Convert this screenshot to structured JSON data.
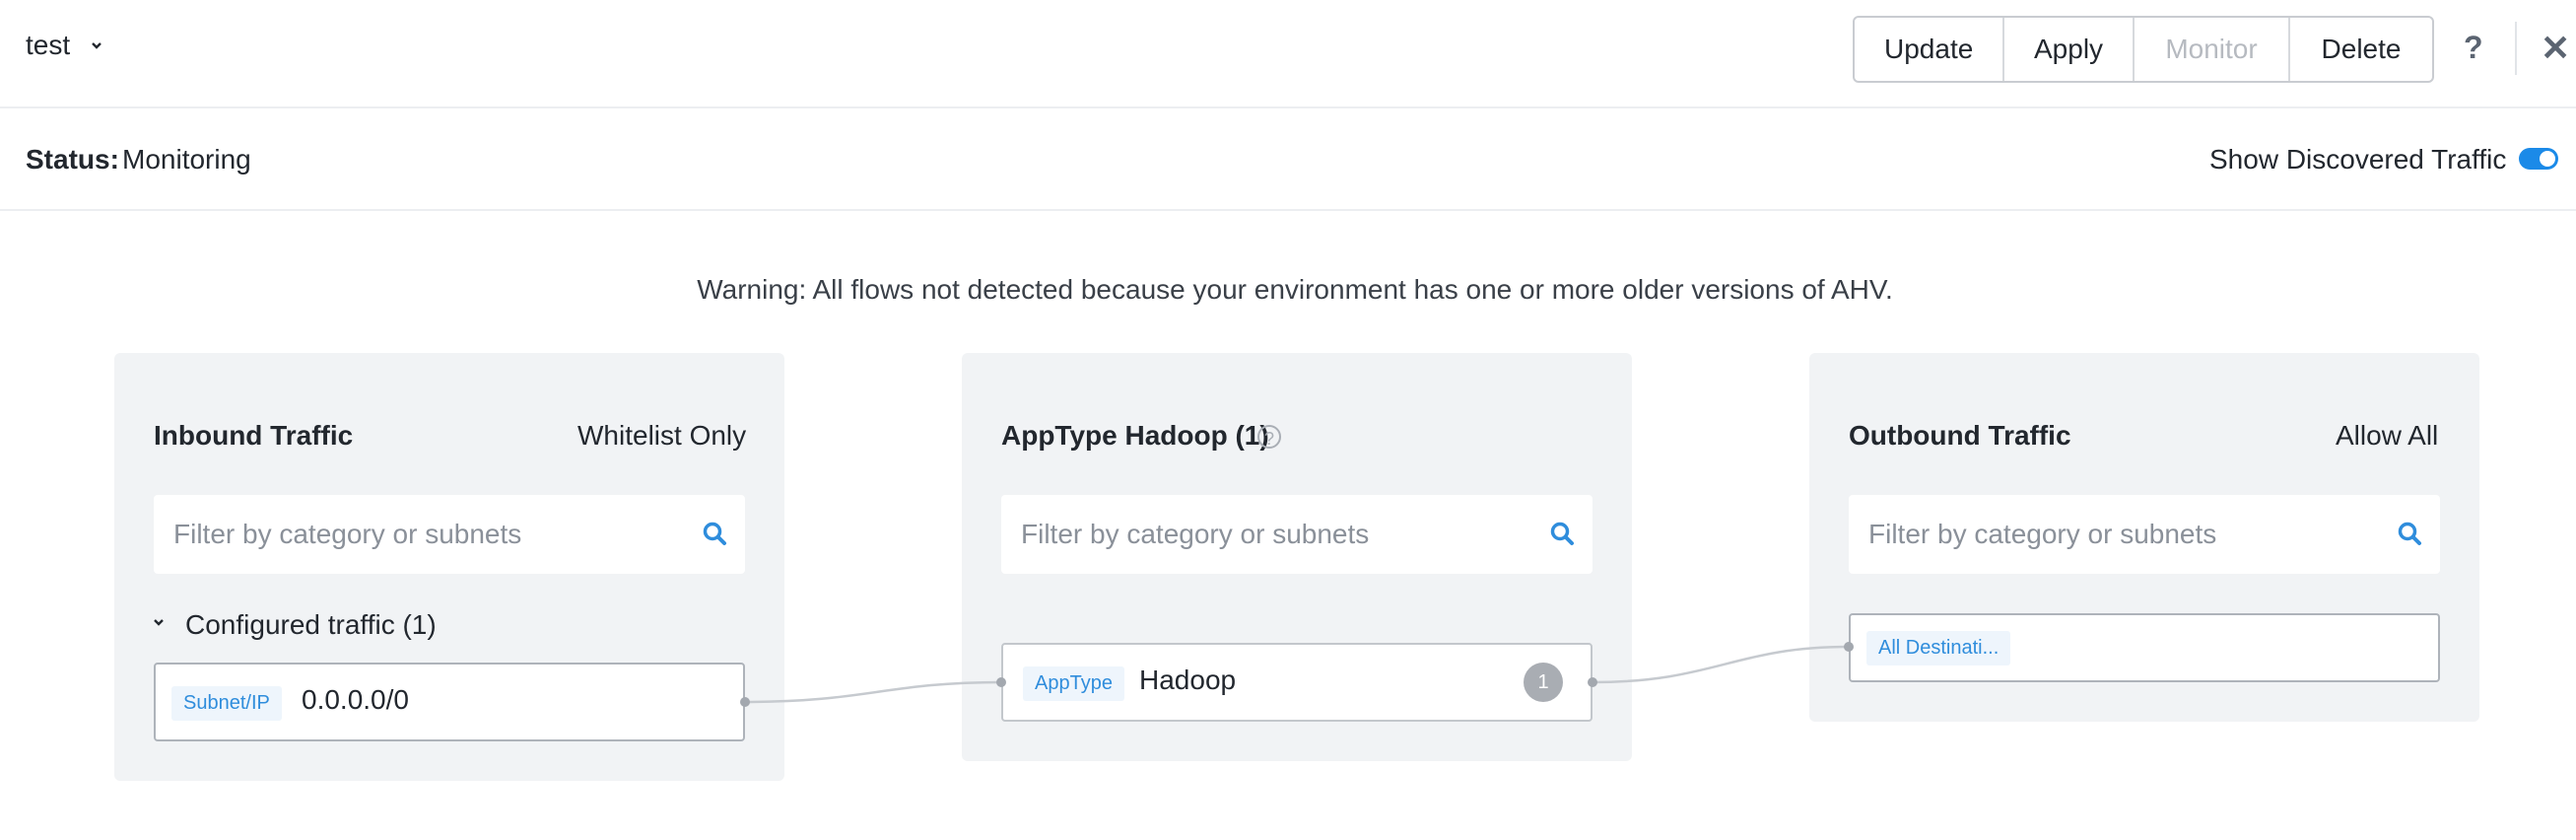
{
  "header": {
    "policy_name": "test",
    "buttons": {
      "update": "Update",
      "apply": "Apply",
      "monitor": "Monitor",
      "delete": "Delete"
    },
    "help": "?",
    "close": "✕"
  },
  "status": {
    "label": "Status:",
    "value": "Monitoring",
    "toggle_label": "Show Discovered Traffic",
    "toggle_on": true
  },
  "warning": "Warning: All flows not detected because your environment has one or more older versions of AHV.",
  "inbound": {
    "title": "Inbound Traffic",
    "mode": "Whitelist Only",
    "search_placeholder": "Filter by category or subnets",
    "section_label": "Configured traffic (1)",
    "item": {
      "tag": "Subnet/IP",
      "value": "0.0.0.0/0"
    }
  },
  "apptype": {
    "title": "AppType Hadoop (1)",
    "help": "?",
    "search_placeholder": "Filter by category or subnets",
    "item": {
      "tag": "AppType",
      "value": "Hadoop",
      "count": "1"
    }
  },
  "outbound": {
    "title": "Outbound Traffic",
    "mode": "Allow All",
    "search_placeholder": "Filter by category or subnets",
    "item": {
      "tag": "All Destinati..."
    }
  },
  "colors": {
    "accent": "#1b8ae8",
    "tag_text": "#2f8ddc",
    "panel_bg": "#f1f3f5"
  }
}
